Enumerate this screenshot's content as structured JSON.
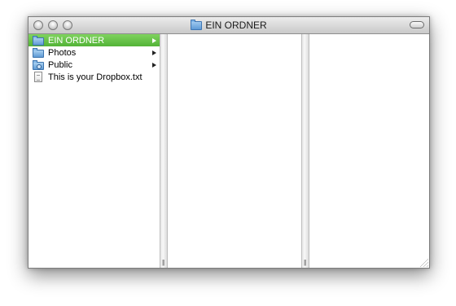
{
  "window": {
    "title": "EIN ORDNER",
    "title_icon": "folder-icon"
  },
  "browser": {
    "items": [
      {
        "label": "EIN ORDNER",
        "icon": "folder-icon",
        "has_children": true,
        "selected": true
      },
      {
        "label": "Photos",
        "icon": "folder-icon",
        "has_children": true,
        "selected": false
      },
      {
        "label": "Public",
        "icon": "public-folder-icon",
        "has_children": true,
        "selected": false
      },
      {
        "label": "This is your Dropbox.txt",
        "icon": "text-file-icon",
        "has_children": false,
        "selected": false
      }
    ]
  },
  "colors": {
    "selection": "#6cc64c",
    "folder": "#6aa6dd"
  }
}
